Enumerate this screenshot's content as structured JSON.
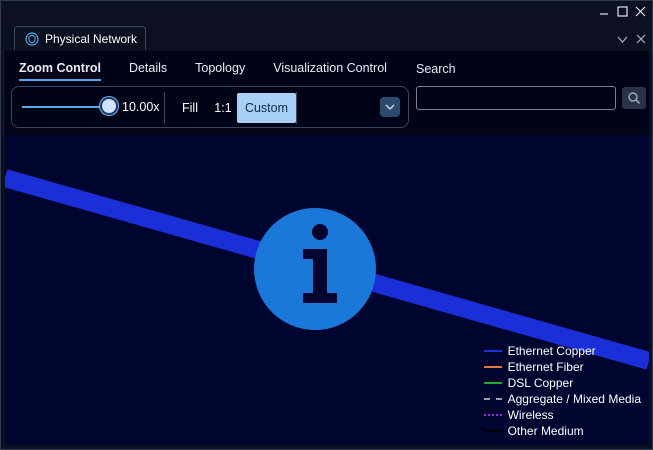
{
  "window": {
    "tab_title": "Physical Network"
  },
  "subtabs": [
    "Zoom Control",
    "Details",
    "Topology",
    "Visualization Control"
  ],
  "search": {
    "label": "Search",
    "value": "",
    "placeholder": ""
  },
  "zoom": {
    "value_label": "10.00x",
    "level": 1.0,
    "fill_label": "Fill",
    "one_to_one_label": "1:1",
    "custom_label": "Custom",
    "selected": "Custom"
  },
  "legend": [
    {
      "label": "Ethernet Copper",
      "color": "#1a2fd8",
      "style": "solid"
    },
    {
      "label": "Ethernet Fiber",
      "color": "#e0783a",
      "style": "solid"
    },
    {
      "label": "DSL Copper",
      "color": "#1fae2c",
      "style": "solid"
    },
    {
      "label": "Aggregate / Mixed Media",
      "color": "#9aa0aa",
      "style": "dashed"
    },
    {
      "label": "Wireless",
      "color": "#9b2fd4",
      "style": "dotted"
    },
    {
      "label": "Other Medium",
      "color": "#000000",
      "style": "solid"
    }
  ],
  "colors": {
    "accent": "#4fa8f0",
    "canvas_bg": "#000530",
    "link_line": "#1a2fd8",
    "info_circle": "#1a78d8"
  },
  "icons": {
    "tab": "network-shield-icon",
    "info": "info-icon",
    "search": "search-icon",
    "dropdown": "chevron-down-icon"
  }
}
